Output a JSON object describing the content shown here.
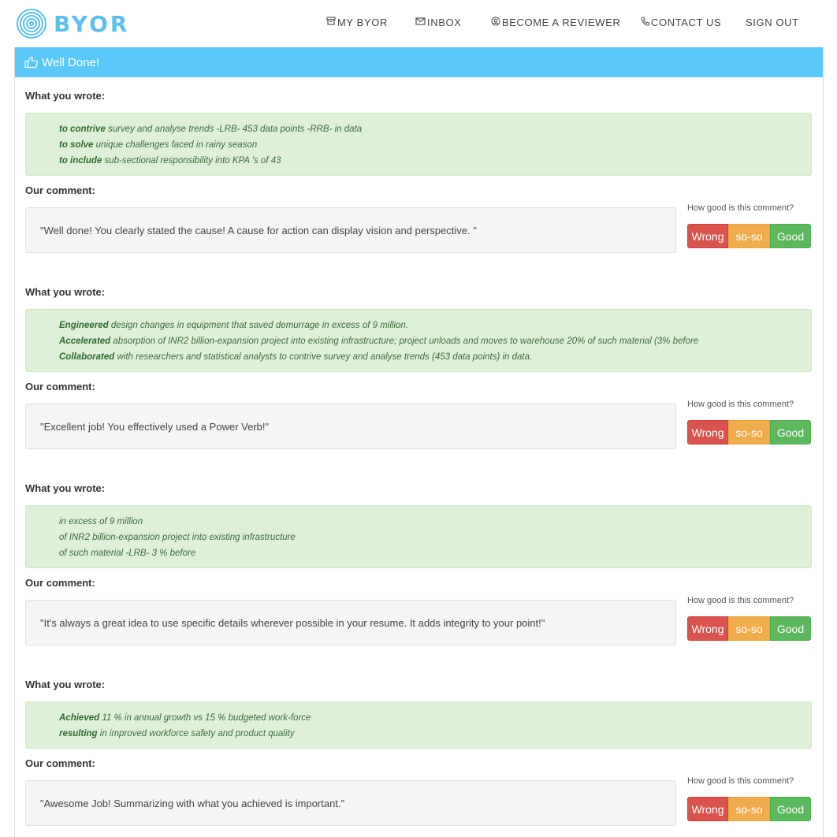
{
  "brand": {
    "name": "BYOR",
    "accent": "#5bc0f0"
  },
  "nav": [
    {
      "icon": "archive-icon",
      "label": "MY BYOR"
    },
    {
      "icon": "envelope-icon",
      "label": "INBOX"
    },
    {
      "icon": "user-circle-icon",
      "label": "BECOME A REVIEWER"
    },
    {
      "icon": "phone-icon",
      "label": "CONTACT US"
    },
    {
      "icon": "",
      "label": "SIGN OUT"
    }
  ],
  "panel": {
    "icon": "thumbs-up-icon",
    "title": "Well Done!",
    "color": "#5bc8fa"
  },
  "labels": {
    "wrote": "What you wrote:",
    "comment": "Our comment:",
    "rating_question": "How good is this comment?",
    "wrong": "Wrong",
    "soso": "so-so",
    "good": "Good"
  },
  "feedback": [
    {
      "items": [
        {
          "bold": "to contrive",
          "rest": " survey and analyse trends -LRB- 453 data points -RRB- in data"
        },
        {
          "bold": "to solve",
          "rest": " unique challenges faced in rainy season"
        },
        {
          "bold": "to include",
          "rest": " sub-sectional responsibility into KPA 's of 43"
        }
      ],
      "comment": "\"Well done! You clearly stated the cause! A cause for action can display vision and perspective. \""
    },
    {
      "items": [
        {
          "bold": "Engineered",
          "rest": " design changes in equipment that saved demurrage in excess of 9 million."
        },
        {
          "bold": "Accelerated",
          "rest": " absorption of INR2 billion-expansion project into existing infrastructure; project unloads and moves to warehouse 20% of such material (3% before"
        },
        {
          "bold": "Collaborated",
          "rest": " with researchers and statistical analysts to contrive survey and analyse trends (453 data points) in data."
        }
      ],
      "comment": "\"Excellent job! You effectively used a Power Verb!\""
    },
    {
      "items": [
        {
          "bold": "",
          "rest": "in excess of 9 million"
        },
        {
          "bold": "",
          "rest": "of INR2 billion-expansion project into existing infrastructure"
        },
        {
          "bold": "",
          "rest": "of such material -LRB- 3 % before"
        }
      ],
      "comment": "\"It's always a great idea to use specific details wherever possible in your resume. It adds integrity to your point!\""
    },
    {
      "items": [
        {
          "bold": "Achieved",
          "rest": " 11 % in annual growth vs 15 % budgeted work-force"
        },
        {
          "bold": "resulting",
          "rest": " in improved workforce safety and product quality"
        }
      ],
      "comment": "\"Awesome Job! Summarizing with what you achieved is important.\""
    }
  ]
}
